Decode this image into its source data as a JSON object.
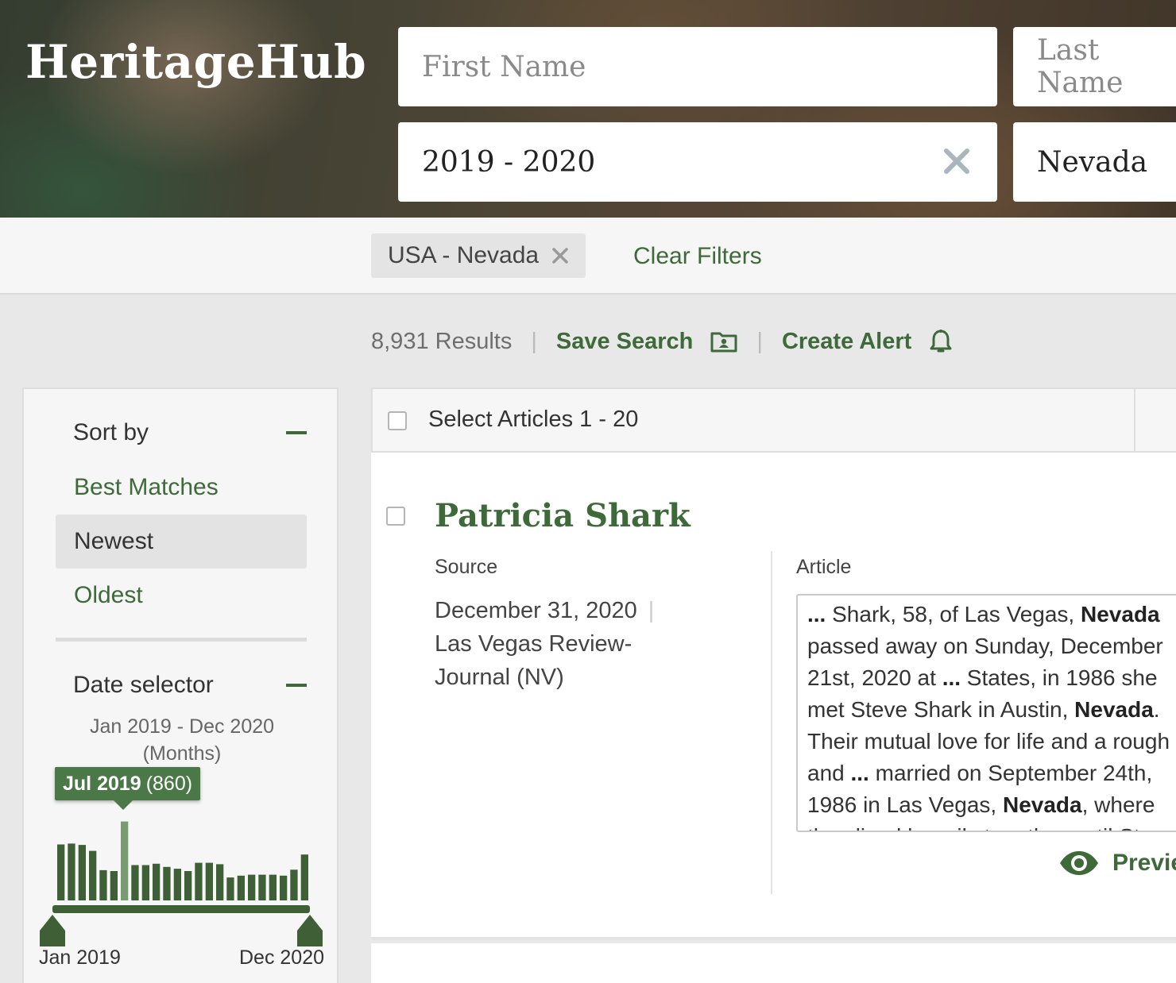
{
  "brand": {
    "name": "HeritageHub"
  },
  "search": {
    "first_name_placeholder": "First Name",
    "last_name_placeholder": "Last Name",
    "date_value": "2019 - 2020",
    "location_value": "Nevada"
  },
  "filters": {
    "chips": [
      {
        "label": "USA - Nevada"
      }
    ],
    "clear_label": "Clear Filters"
  },
  "results_bar": {
    "count_label": "8,931 Results",
    "separator": "|",
    "save_search_label": "Save Search",
    "create_alert_label": "Create Alert"
  },
  "sidebar": {
    "sort": {
      "title": "Sort by",
      "options": [
        {
          "label": "Best Matches",
          "active": false
        },
        {
          "label": "Newest",
          "active": true
        },
        {
          "label": "Oldest",
          "active": false
        }
      ]
    },
    "date_selector": {
      "title": "Date selector",
      "range_text": "Jan 2019 - Dec 2020",
      "unit_text": "(Months)",
      "tooltip_month": "Jul 2019",
      "tooltip_count": "(860)",
      "start_label": "Jan 2019",
      "end_label": "Dec 2020"
    }
  },
  "results": {
    "select_label": "Select Articles 1 - 20",
    "items": [
      {
        "title": "Patricia Shark",
        "source_label": "Source",
        "date": "December 31, 2020",
        "publication": "Las Vegas Review-Journal (NV)",
        "article_label": "Article",
        "preview_label": "Preview"
      }
    ]
  },
  "colors": {
    "accent_green": "#3e6a3a",
    "bar_green": "#3f5f36",
    "highlight_bar": "#7a9a72"
  },
  "chart_data": {
    "type": "bar",
    "title": "",
    "xlabel": "",
    "ylabel": "",
    "categories": [
      "Jan 2019",
      "Feb 2019",
      "Mar 2019",
      "Apr 2019",
      "May 2019",
      "Jun 2019",
      "Jul 2019",
      "Aug 2019",
      "Sep 2019",
      "Oct 2019",
      "Nov 2019",
      "Dec 2019",
      "Jan 2020",
      "Feb 2020",
      "Mar 2020",
      "Apr 2020",
      "May 2020",
      "Jun 2020",
      "Jul 2020",
      "Aug 2020",
      "Sep 2020",
      "Oct 2020",
      "Nov 2020",
      "Dec 2020"
    ],
    "values": [
      610,
      620,
      605,
      540,
      330,
      320,
      860,
      385,
      385,
      400,
      365,
      345,
      320,
      410,
      410,
      395,
      250,
      270,
      280,
      280,
      280,
      270,
      335,
      500
    ],
    "highlight_index": 6,
    "ylim": [
      0,
      900
    ],
    "range_start": "Jan 2019",
    "range_end": "Dec 2020"
  }
}
